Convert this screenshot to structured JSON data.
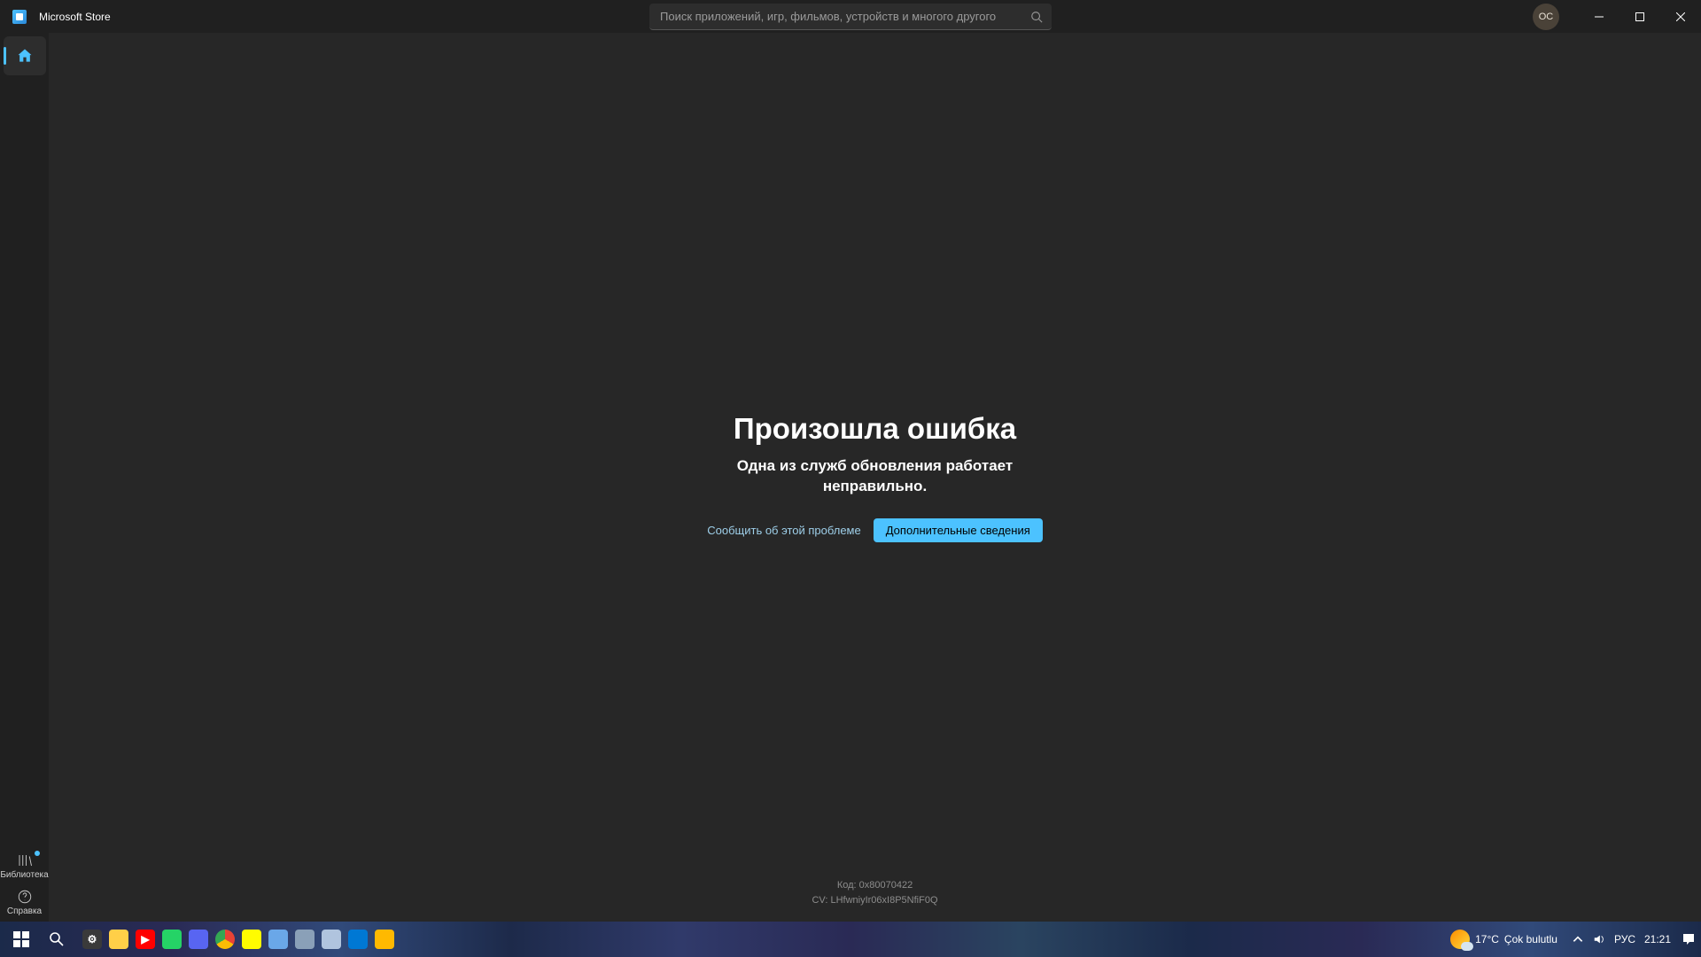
{
  "titlebar": {
    "app_title": "Microsoft Store",
    "search_placeholder": "Поиск приложений, игр, фильмов, устройств и многого другого",
    "profile_initials": "OC"
  },
  "sidebar": {
    "library_label": "Библиотека",
    "help_label": "Справка"
  },
  "error": {
    "title": "Произошла ошибка",
    "subtitle_line1": "Одна из служб обновления работает",
    "subtitle_line2": "неправильно.",
    "report_link": "Сообщить об этой проблеме",
    "more_info_button": "Дополнительные сведения",
    "code_line": "Код: 0x80070422",
    "cv_line": "CV: LHfwniyIr06xI8P5NfiF0Q"
  },
  "taskbar": {
    "weather_temp": "17°C",
    "weather_desc": "Çok bulutlu",
    "lang": "РУС",
    "time": "21:21"
  }
}
